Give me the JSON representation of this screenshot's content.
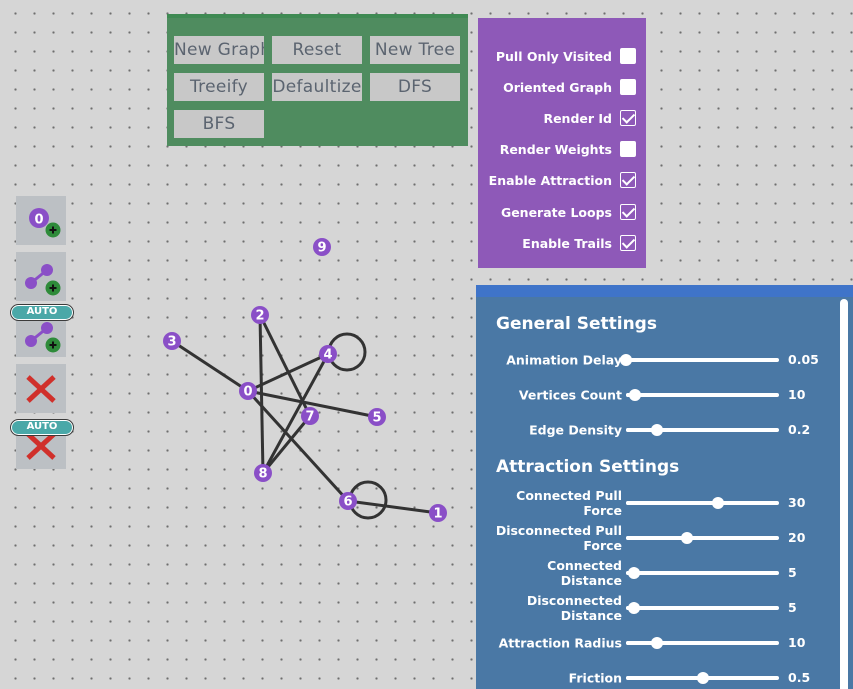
{
  "toolbar": {
    "buttons": [
      "New Graph",
      "Reset",
      "New Tree",
      "Treeify",
      "Defaultize",
      "DFS",
      "BFS"
    ]
  },
  "options": {
    "items": [
      {
        "label": "Pull Only Visited",
        "checked": false
      },
      {
        "label": "Oriented Graph",
        "checked": false
      },
      {
        "label": "Render Id",
        "checked": true
      },
      {
        "label": "Render Weights",
        "checked": false
      },
      {
        "label": "Enable Attraction",
        "checked": true
      },
      {
        "label": "Generate Loops",
        "checked": true
      },
      {
        "label": "Enable Trails",
        "checked": true
      }
    ]
  },
  "tools": {
    "add_vertex_label": "0",
    "auto_badge_1": "AUTO",
    "auto_badge_2": "AUTO"
  },
  "settings": {
    "general_title": "General Settings",
    "attraction_title": "Attraction Settings",
    "general": [
      {
        "label": "Animation Delay",
        "value": "0.05",
        "fraction": 0.0
      },
      {
        "label": "Vertices Count",
        "value": "10",
        "fraction": 0.06
      },
      {
        "label": "Edge Density",
        "value": "0.2",
        "fraction": 0.2
      }
    ],
    "attraction": [
      {
        "label": "Connected Pull Force",
        "value": "30",
        "fraction": 0.6
      },
      {
        "label": "Disconnected Pull Force",
        "value": "20",
        "fraction": 0.4
      },
      {
        "label": "Connected Distance",
        "value": "5",
        "fraction": 0.05
      },
      {
        "label": "Disconnected Distance",
        "value": "5",
        "fraction": 0.05
      },
      {
        "label": "Attraction Radius",
        "value": "10",
        "fraction": 0.2
      },
      {
        "label": "Friction",
        "value": "0.5",
        "fraction": 0.5
      }
    ]
  },
  "graph": {
    "vertices": [
      {
        "id": "0"
      },
      {
        "id": "1"
      },
      {
        "id": "2"
      },
      {
        "id": "3"
      },
      {
        "id": "4"
      },
      {
        "id": "5"
      },
      {
        "id": "6"
      },
      {
        "id": "7"
      },
      {
        "id": "8"
      },
      {
        "id": "9"
      }
    ],
    "edges": [
      [
        "0",
        "3"
      ],
      [
        "0",
        "5"
      ],
      [
        "0",
        "6"
      ],
      [
        "0",
        "4"
      ],
      [
        "2",
        "7"
      ],
      [
        "2",
        "8"
      ],
      [
        "4",
        "8"
      ],
      [
        "7",
        "8"
      ],
      [
        "6",
        "1"
      ]
    ],
    "loops": [
      "4",
      "6"
    ]
  },
  "colors": {
    "vertex": "#8a4fc7",
    "edge": "#333333",
    "toolbar_bg": "#4f8c5f",
    "options_bg": "#8e59b8",
    "settings_bg": "#4a78a5",
    "settings_header": "#3f74c9",
    "auto_badge": "#4aa8a8",
    "delete_x": "#d0302b"
  }
}
